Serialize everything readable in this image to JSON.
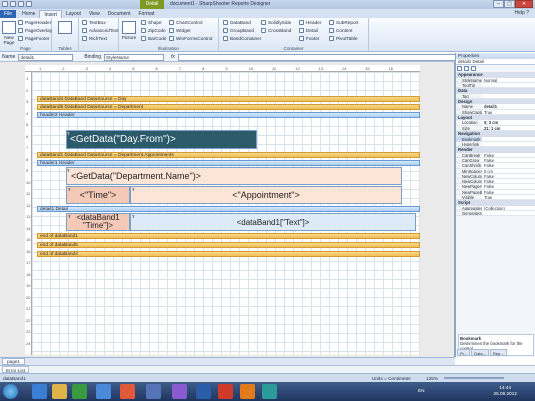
{
  "window": {
    "title": "document1 - SharpShooter Reports Designer",
    "context_tab": "Detail"
  },
  "tabs": [
    "File",
    "Home",
    "Insert",
    "Layout",
    "View",
    "Document",
    "Format"
  ],
  "help_label": "Help",
  "ribbon": {
    "page_group": {
      "label": "Page",
      "new_page": "New Page",
      "items": [
        "PageHeader",
        "PageOverlay",
        "PageFooter"
      ]
    },
    "tables_group": {
      "label": "Tables"
    },
    "controls_group": {
      "items": [
        "TextBox",
        "AdvancedText",
        "RichText"
      ]
    },
    "illustration_group": {
      "label": "Illustration",
      "picture": "Picture",
      "shape": "Shape",
      "zipcode": "ZipCode",
      "barcode": "BarCode",
      "items2": [
        "ChartControl",
        "Widget",
        "WinFormsControl"
      ]
    },
    "container_group": {
      "label": "Container",
      "items": [
        "DataBand",
        "GroupBand",
        "BandContainer"
      ],
      "items2": [
        "SolidlySide",
        "CrossBand"
      ],
      "items3": [
        "Header",
        "Detail",
        "Footer"
      ],
      "items4": [
        "SubReport",
        "Content",
        "PivotTable"
      ]
    }
  },
  "name_row": {
    "name_label": "Name",
    "name_value": "detail1",
    "binding_label": "Binding",
    "binding_value": "StyleName",
    "fx": "fx"
  },
  "ruler": [
    "1",
    "2",
    "3",
    "4",
    "5",
    "6",
    "7",
    "8",
    "9",
    "10",
    "11",
    "12",
    "13",
    "14",
    "15",
    "16"
  ],
  "vruler": [
    "1",
    "2",
    "3",
    "4",
    "5",
    "6",
    "7",
    "8",
    "9",
    "10",
    "11",
    "12",
    "13",
    "14",
    "15",
    "16",
    "17",
    "18",
    "19",
    "20",
    "21",
    "22",
    "23",
    "24"
  ],
  "bands": {
    "b1": "dataBand4 DataBand  DataSource = Day",
    "b2": "dataBand5 DataBand  DataSource = Department",
    "b3": "header2 Header",
    "b4": "dataBand1 DataBand  DataSource = Department.Appointments",
    "b5": "header1 Header",
    "b6": "detail1 Detail",
    "b7": "end of dataBand1",
    "b8": "end of dataBand5",
    "b9": "end of dataBand4"
  },
  "fields": {
    "dayfrom": "<GetData(\"Day.From\")>",
    "deptname": "<GetData(\"Department.Name\")>",
    "time": "<\"Time\">",
    "appointment": "<\"Appointment\">",
    "band1time": "<dataBand1",
    "band1time2": "\"Time\"]>",
    "band1text": "<dataBand1[\"Text\"]>",
    "tmark": "T"
  },
  "properties": {
    "title": "Properties",
    "object": "detail1 Detail",
    "categories": {
      "appearance": "Appearance",
      "data": "Data",
      "design": "Design",
      "layout": "Layout",
      "navigation": "Navigation",
      "render": "Render",
      "script": "Script"
    },
    "rows": {
      "stylename": [
        "StyleName",
        "Normal"
      ],
      "tooltip": [
        "ToolTip",
        ""
      ],
      "tag": [
        "Tag",
        ""
      ],
      "name": [
        "Name",
        "detail1"
      ],
      "showcaption": [
        "ShowCaption",
        "True"
      ],
      "location": [
        "Location",
        "0; 3 cm"
      ],
      "size": [
        "Size",
        "21; 1 cm"
      ],
      "bookmark": [
        "Bookmark",
        ""
      ],
      "hyperlink": [
        "Hyperlink",
        ""
      ],
      "canbreak": [
        "CanBreak",
        "False"
      ],
      "cangrow": [
        "CanGrow",
        "False"
      ],
      "canshrink": [
        "CanShrink",
        "False"
      ],
      "minspace": [
        "MinSpaceAt",
        "0 cm"
      ],
      "newcol": [
        "NewColumnA",
        "False"
      ],
      "newcolb": [
        "NewColumnB",
        "False"
      ],
      "newpage": [
        "NewPageAft",
        "False"
      ],
      "newpageb": [
        "NewPageBef",
        "False"
      ],
      "visible": [
        "Visible",
        "True"
      ],
      "aggregates": [
        "Aggregates",
        "(Collection)"
      ],
      "genscript": [
        "GenerateScri",
        ""
      ]
    },
    "desc_title": "Bookmark",
    "desc_text": "Determines the bookmark for the control.",
    "tabs": [
      "Pr...",
      "Data...",
      "Rep..."
    ]
  },
  "page_tab": "page1",
  "error_tab": "Error List",
  "status": {
    "left": "dataBand1",
    "units": "Units = Centimeter",
    "zoom": "125%"
  },
  "clock": {
    "time": "14:44",
    "date": "25.09.2012",
    "lang": "EN"
  }
}
